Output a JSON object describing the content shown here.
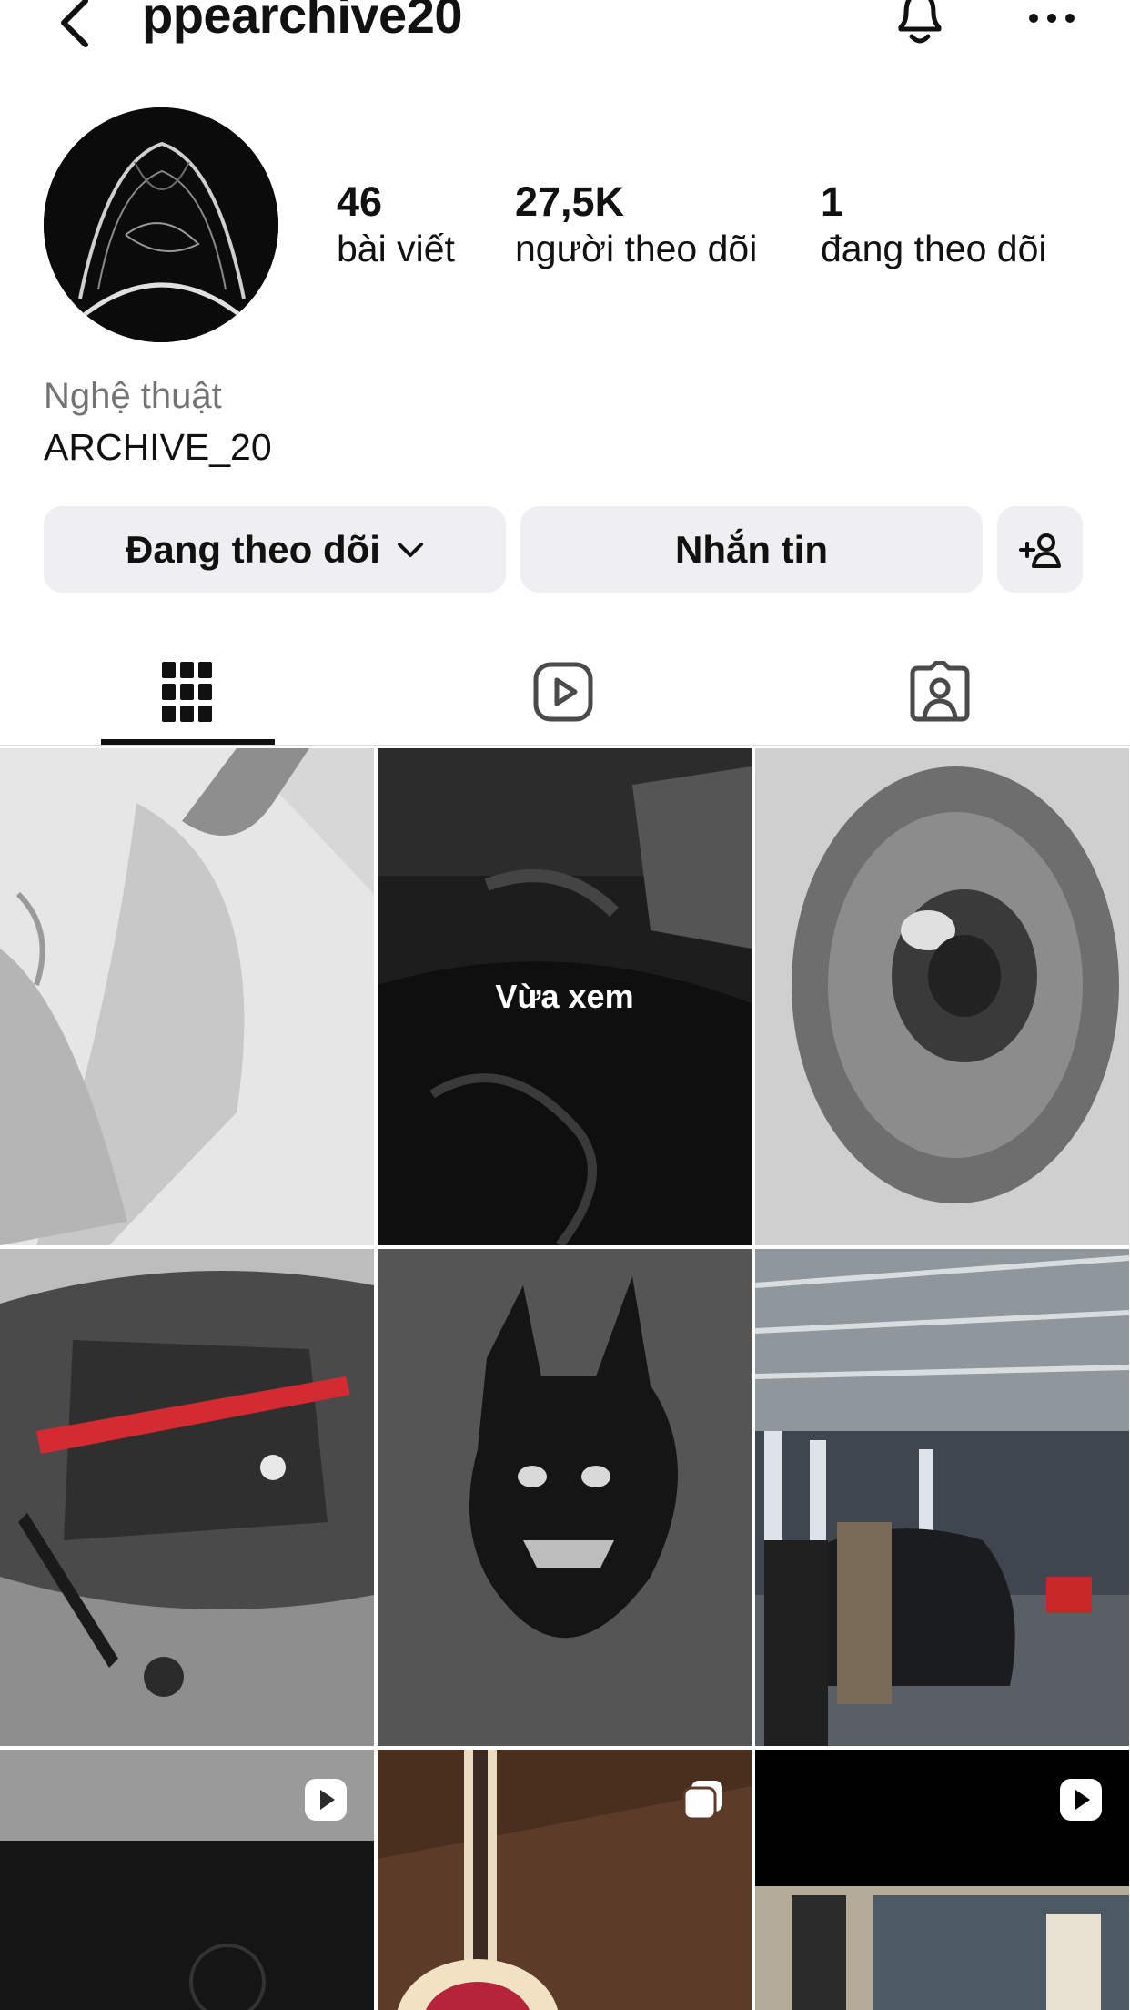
{
  "header": {
    "username": "ppearchive20",
    "icons": [
      "back-chevron-icon",
      "bell-icon",
      "more-dots-icon"
    ]
  },
  "profile": {
    "stats": [
      {
        "value": "46",
        "label": "bài viết"
      },
      {
        "value": "27,5K",
        "label": "người theo dõi"
      },
      {
        "value": "1",
        "label": "đang theo dõi"
      }
    ],
    "category": "Nghệ thuật",
    "bio_name": "ARCHIVE_20"
  },
  "actions": {
    "following_label": "Đang theo dõi",
    "message_label": "Nhắn tin",
    "add_user_icon": "add-person-icon"
  },
  "tabs": [
    {
      "name": "posts",
      "icon": "grid-icon",
      "active": true
    },
    {
      "name": "reels",
      "icon": "reels-icon",
      "active": false
    },
    {
      "name": "tagged",
      "icon": "tagged-person-icon",
      "active": false
    }
  ],
  "grid": {
    "recently_viewed_label": "Vừa xem",
    "posts": [
      {
        "id": "p1",
        "badge": null
      },
      {
        "id": "p2",
        "badge": null,
        "recently_viewed": true
      },
      {
        "id": "p3",
        "badge": null
      },
      {
        "id": "p4",
        "badge": null
      },
      {
        "id": "p5",
        "badge": null
      },
      {
        "id": "p6",
        "badge": null
      },
      {
        "id": "p7",
        "badge": "reel-icon"
      },
      {
        "id": "p8",
        "badge": "carousel-icon"
      },
      {
        "id": "p9",
        "badge": "reel-icon"
      }
    ]
  },
  "colors": {
    "button_bg": "#efeff1",
    "text_primary": "#111111",
    "text_secondary": "#737373",
    "divider": "#dbdbdb"
  }
}
